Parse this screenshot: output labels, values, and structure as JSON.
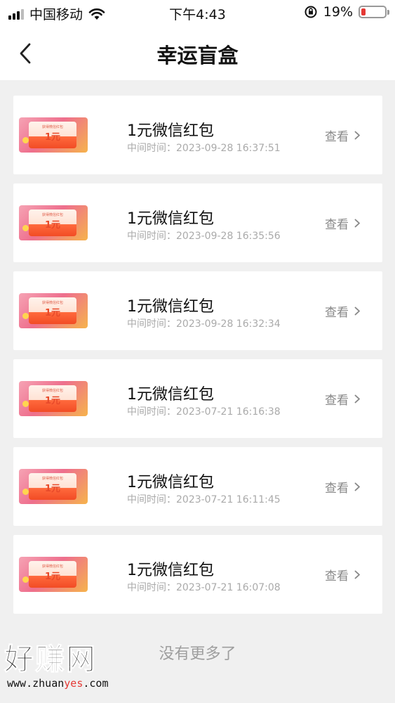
{
  "status_bar": {
    "carrier": "中国移动",
    "time": "下午4:43",
    "battery_pct": "19%",
    "battery_level": 0.19,
    "battery_color": "#e53935"
  },
  "header": {
    "back_icon": "chevron-left-icon",
    "title": "幸运盲盒"
  },
  "records": [
    {
      "title": "1元微信红包",
      "time": "中间时间：2023-09-28 16:37:51",
      "view_label": "查看",
      "thumb_amount": "1元",
      "thumb_caption": "获得微信红包"
    },
    {
      "title": "1元微信红包",
      "time": "中间时间：2023-09-28 16:35:56",
      "view_label": "查看",
      "thumb_amount": "1元",
      "thumb_caption": "获得微信红包"
    },
    {
      "title": "1元微信红包",
      "time": "中间时间：2023-09-28 16:32:34",
      "view_label": "查看",
      "thumb_amount": "1元",
      "thumb_caption": "获得微信红包"
    },
    {
      "title": "1元微信红包",
      "time": "中间时间：2023-07-21 16:16:38",
      "view_label": "查看",
      "thumb_amount": "1元",
      "thumb_caption": "获得微信红包"
    },
    {
      "title": "1元微信红包",
      "time": "中间时间：2023-07-21 16:11:45",
      "view_label": "查看",
      "thumb_amount": "1元",
      "thumb_caption": "获得微信红包"
    },
    {
      "title": "1元微信红包",
      "time": "中间时间：2023-07-21 16:07:08",
      "view_label": "查看",
      "thumb_amount": "1元",
      "thumb_caption": "获得微信红包"
    }
  ],
  "footer": {
    "no_more": "没有更多了"
  },
  "watermark": {
    "name": "好赚网",
    "url_prefix": "www.zhuan",
    "url_highlight": "yes",
    "url_suffix": ".com"
  }
}
